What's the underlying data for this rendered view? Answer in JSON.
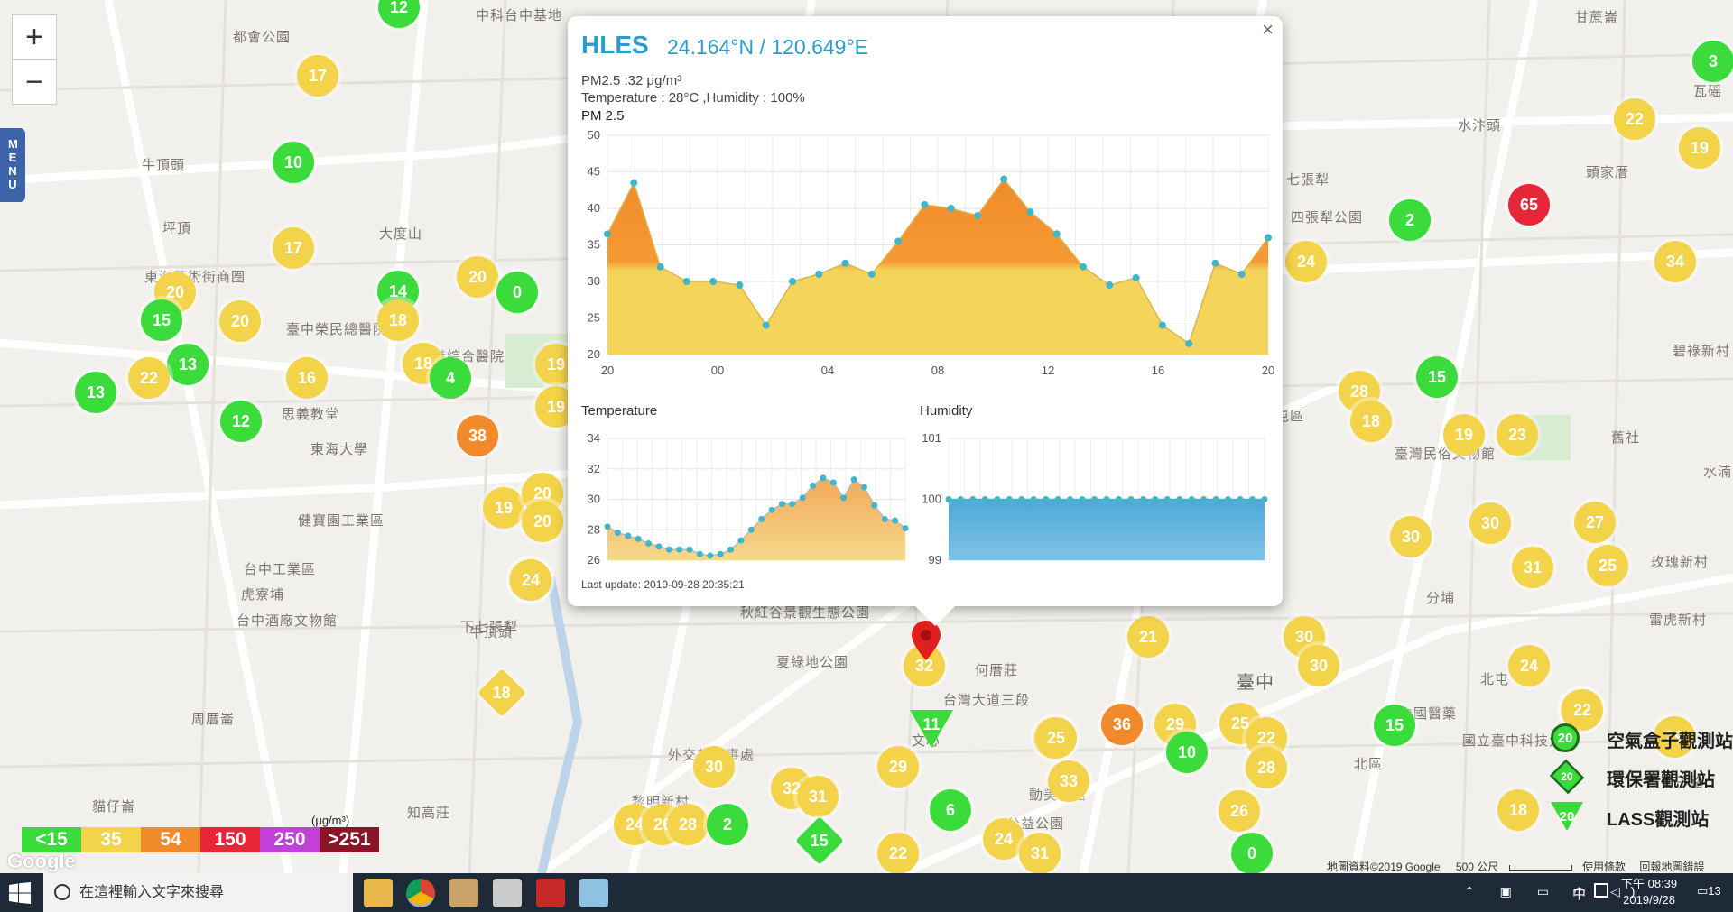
{
  "map": {
    "labels": [
      "中科台中基地",
      "都會公園",
      "牛頂頭",
      "坪頂",
      "東海藝術街商圈",
      "大度山",
      "臺中榮民總醫院",
      "思義教堂",
      "東海大學",
      "中港綜合醫院",
      "牛頂頭",
      "台中工業區",
      "虎寮埔",
      "台中酒廠文物館",
      "下七張犁",
      "周厝崙",
      "貓仔崙",
      "知高莊",
      "黎明新村",
      "外交部辦事處",
      "夏綠地公園",
      "何厝莊",
      "台灣大道三段",
      "文心",
      "臺中",
      "北屯區",
      "四張犁公園",
      "七張犁",
      "頭家厝",
      "水汴頭",
      "甘蔗崙",
      "瓦磘",
      "碧祿新村",
      "舊社",
      "分埔",
      "玫瑰新村",
      "雷虎新村",
      "北屯",
      "北區",
      "國立臺中科技大學",
      "動美術館",
      "公益公園",
      "秋紅谷景觀生態公園",
      "臺灣民俗文物館",
      "水湳",
      "番子路",
      "中國醫藥",
      "健寶園工業區"
    ],
    "markers": [
      {
        "v": "12",
        "t": "c",
        "c": "#3cdb3c"
      },
      {
        "v": "17",
        "t": "c",
        "c": "#f3d34a"
      },
      {
        "v": "10",
        "t": "c",
        "c": "#3cdb3c"
      },
      {
        "v": "17",
        "t": "c",
        "c": "#f3d34a"
      },
      {
        "v": "20",
        "t": "c",
        "c": "#f3d34a"
      },
      {
        "v": "15",
        "t": "c",
        "c": "#3cdb3c"
      },
      {
        "v": "20",
        "t": "c",
        "c": "#f3d34a"
      },
      {
        "v": "13",
        "t": "c",
        "c": "#3cdb3c"
      },
      {
        "v": "13",
        "t": "c",
        "c": "#3cdb3c"
      },
      {
        "v": "22",
        "t": "c",
        "c": "#f3d34a"
      },
      {
        "v": "16",
        "t": "c",
        "c": "#f3d34a"
      },
      {
        "v": "12",
        "t": "c",
        "c": "#3cdb3c"
      },
      {
        "v": "14",
        "t": "c",
        "c": "#3cdb3c"
      },
      {
        "v": "18",
        "t": "c",
        "c": "#f3d34a"
      },
      {
        "v": "20",
        "t": "c",
        "c": "#f3d34a"
      },
      {
        "v": "0",
        "t": "c",
        "c": "#3cdb3c"
      },
      {
        "v": "18",
        "t": "c",
        "c": "#f3d34a"
      },
      {
        "v": "4",
        "t": "c",
        "c": "#3cdb3c"
      },
      {
        "v": "38",
        "t": "c",
        "c": "#f08a2a"
      },
      {
        "v": "19",
        "t": "c",
        "c": "#f3d34a"
      },
      {
        "v": "20",
        "t": "c",
        "c": "#f3d34a"
      },
      {
        "v": "20",
        "t": "c",
        "c": "#f3d34a"
      },
      {
        "v": "24",
        "t": "c",
        "c": "#f3d34a"
      },
      {
        "v": "18",
        "t": "d",
        "c": "#f3d34a"
      },
      {
        "v": "19",
        "t": "c",
        "c": "#f3d34a"
      },
      {
        "v": "19",
        "t": "c",
        "c": "#f3d34a"
      },
      {
        "v": "32",
        "t": "c",
        "c": "#f3d34a"
      },
      {
        "v": "11",
        "t": "t",
        "c": "#3cdb3c"
      },
      {
        "v": "21",
        "t": "c",
        "c": "#f3d34a"
      },
      {
        "v": "25",
        "t": "c",
        "c": "#f3d34a"
      },
      {
        "v": "29",
        "t": "c",
        "c": "#f3d34a"
      },
      {
        "v": "30",
        "t": "c",
        "c": "#f3d34a"
      },
      {
        "v": "32",
        "t": "c",
        "c": "#f3d34a"
      },
      {
        "v": "31",
        "t": "c",
        "c": "#f3d34a"
      },
      {
        "v": "6",
        "t": "c",
        "c": "#3cdb3c"
      },
      {
        "v": "15",
        "t": "d",
        "c": "#3cdb3c"
      },
      {
        "v": "22",
        "t": "c",
        "c": "#f3d34a"
      },
      {
        "v": "24",
        "t": "c",
        "c": "#f3d34a"
      },
      {
        "v": "31",
        "t": "c",
        "c": "#f3d34a"
      },
      {
        "v": "33",
        "t": "c",
        "c": "#f3d34a"
      },
      {
        "v": "25",
        "t": "c",
        "c": "#f3d34a"
      },
      {
        "v": "36",
        "t": "c",
        "c": "#f08a2a"
      },
      {
        "v": "29",
        "t": "c",
        "c": "#f3d34a"
      },
      {
        "v": "10",
        "t": "c",
        "c": "#3cdb3c"
      },
      {
        "v": "25",
        "t": "c",
        "c": "#f3d34a"
      },
      {
        "v": "22",
        "t": "c",
        "c": "#f3d34a"
      },
      {
        "v": "28",
        "t": "c",
        "c": "#f3d34a"
      },
      {
        "v": "26",
        "t": "c",
        "c": "#f3d34a"
      },
      {
        "v": "0",
        "t": "c",
        "c": "#3cdb3c"
      },
      {
        "v": "30",
        "t": "c",
        "c": "#f3d34a"
      },
      {
        "v": "30",
        "t": "c",
        "c": "#f3d34a"
      },
      {
        "v": "24",
        "t": "c",
        "c": "#f3d34a"
      },
      {
        "v": "15",
        "t": "c",
        "c": "#3cdb3c"
      },
      {
        "v": "22",
        "t": "c",
        "c": "#f3d34a"
      },
      {
        "v": "29",
        "t": "c",
        "c": "#f3d34a"
      },
      {
        "v": "24",
        "t": "c",
        "c": "#f3d34a"
      },
      {
        "v": "26",
        "t": "c",
        "c": "#f3d34a"
      },
      {
        "v": "28",
        "t": "c",
        "c": "#f3d34a"
      },
      {
        "v": "2",
        "t": "c",
        "c": "#3cdb3c"
      },
      {
        "v": "24",
        "t": "c",
        "c": "#f3d34a"
      },
      {
        "v": "2",
        "t": "c",
        "c": "#3cdb3c"
      },
      {
        "v": "65",
        "t": "c",
        "c": "#e8263a"
      },
      {
        "v": "3",
        "t": "c",
        "c": "#3cdb3c"
      },
      {
        "v": "22",
        "t": "c",
        "c": "#f3d34a"
      },
      {
        "v": "19",
        "t": "c",
        "c": "#f3d34a"
      },
      {
        "v": "34",
        "t": "c",
        "c": "#f3d34a"
      },
      {
        "v": "15",
        "t": "c",
        "c": "#3cdb3c"
      },
      {
        "v": "28",
        "t": "c",
        "c": "#f3d34a"
      },
      {
        "v": "18",
        "t": "c",
        "c": "#f3d34a"
      },
      {
        "v": "19",
        "t": "c",
        "c": "#f3d34a"
      },
      {
        "v": "23",
        "t": "c",
        "c": "#f3d34a"
      },
      {
        "v": "30",
        "t": "c",
        "c": "#f3d34a"
      },
      {
        "v": "30",
        "t": "c",
        "c": "#f3d34a"
      },
      {
        "v": "27",
        "t": "c",
        "c": "#f3d34a"
      },
      {
        "v": "31",
        "t": "c",
        "c": "#f3d34a"
      },
      {
        "v": "25",
        "t": "c",
        "c": "#f3d34a"
      },
      {
        "v": "24",
        "t": "c",
        "c": "#f3d34a"
      },
      {
        "v": "22",
        "t": "c",
        "c": "#f3d34a"
      },
      {
        "v": "18",
        "t": "c",
        "c": "#f3d34a"
      }
    ]
  },
  "menu": {
    "label": "MENU"
  },
  "zoom": {
    "in": "+",
    "out": "−"
  },
  "popup": {
    "close": "×",
    "station": "HLES",
    "coordinates": "24.164°N / 120.649°E",
    "pm25_text": "PM2.5 :32 μg/m³",
    "temp_humidity_text": "Temperature : 28°C ,Humidity : 100%",
    "last_update": "Last update: 2019-09-28 20:35:21"
  },
  "chart_data": [
    {
      "type": "area",
      "title": "PM 2.5",
      "x_ticks": [
        "20",
        "00",
        "04",
        "08",
        "12",
        "16",
        "20"
      ],
      "ylim": [
        20,
        50
      ],
      "y_ticks": [
        20,
        25,
        30,
        35,
        40,
        45,
        50
      ],
      "threshold": 35,
      "values": [
        36.5,
        43.5,
        32,
        30,
        30,
        29.5,
        24,
        30,
        31,
        32.5,
        31,
        35.5,
        40.5,
        40,
        39,
        44,
        39.5,
        36.5,
        32,
        29.5,
        30.5,
        24,
        21.5,
        32.5,
        31,
        36
      ]
    },
    {
      "type": "area",
      "title": "Temperature",
      "ylim": [
        26,
        34
      ],
      "y_ticks": [
        26,
        28,
        30,
        32,
        34
      ],
      "values": [
        28.2,
        27.8,
        27.6,
        27.4,
        27.1,
        26.9,
        26.7,
        26.7,
        26.7,
        26.4,
        26.3,
        26.4,
        26.7,
        27.3,
        28.0,
        28.7,
        29.3,
        29.7,
        29.7,
        30.1,
        30.9,
        31.4,
        31.1,
        30.1,
        31.3,
        30.8,
        29.6,
        28.7,
        28.6,
        28.1
      ]
    },
    {
      "type": "area",
      "title": "Humidity",
      "ylim": [
        99,
        101
      ],
      "y_ticks": [
        99,
        100,
        101
      ],
      "values": [
        100,
        100,
        100,
        100,
        100,
        100,
        100,
        100,
        100,
        100,
        100,
        100,
        100,
        100,
        100,
        100,
        100,
        100,
        100,
        100,
        100,
        100,
        100,
        100,
        100,
        100,
        100
      ]
    }
  ],
  "legend": {
    "unit": "(μg/m³)",
    "scale": [
      {
        "label": "<15",
        "color": "#3cdb3c"
      },
      {
        "label": "35",
        "color": "#f3d34a"
      },
      {
        "label": "54",
        "color": "#f08a2a"
      },
      {
        "label": "150",
        "color": "#e8263a"
      },
      {
        "label": "250",
        "color": "#c040d8"
      },
      {
        "label": ">251",
        "color": "#8b1426"
      }
    ],
    "stations": [
      {
        "label": "空氣盒子觀測站",
        "value": "20"
      },
      {
        "label": "環保署觀測站",
        "value": "20"
      },
      {
        "label": "LASS觀測站",
        "value": "20"
      }
    ]
  },
  "attribution": {
    "google": "Google",
    "data": "地圖資料©2019 Google",
    "scale": "500 公尺",
    "terms": "使用條款",
    "report": "回報地圖錯誤"
  },
  "taskbar": {
    "search_placeholder": "在這裡輸入文字來搜尋",
    "time": "下午 08:39",
    "date": "2019/9/28",
    "ime": "中",
    "notifications": "13"
  }
}
